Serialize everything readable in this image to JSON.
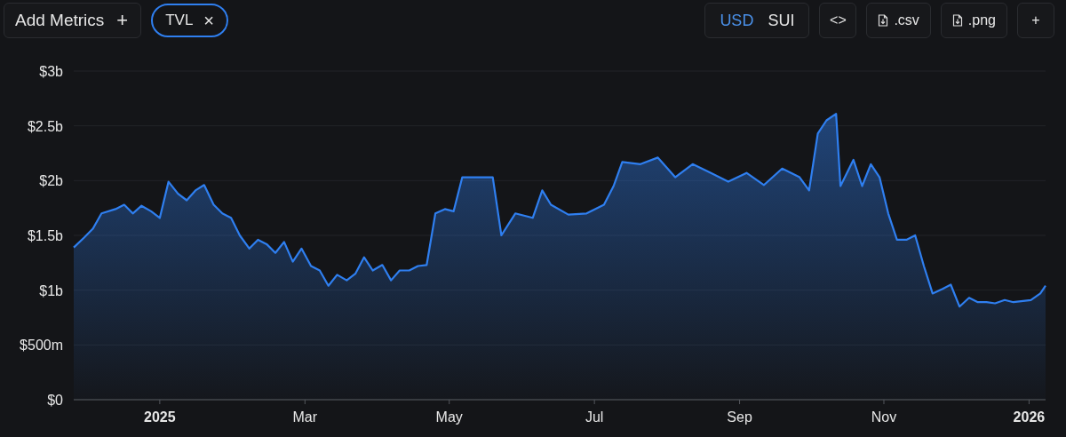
{
  "toolbar": {
    "add_metrics": {
      "label": "Add Metrics",
      "icon": "+"
    },
    "metric_tags": [
      {
        "remove": "×"
      }
    ],
    "units": [
      {
        "label": "USD",
        "selected": true
      },
      {
        "label": "SUI",
        "selected": false
      }
    ],
    "embed": {
      "icon": "<>"
    },
    "downloads": [
      {
        "label": ".csv"
      },
      {
        "label": ".png"
      }
    ],
    "add": {
      "icon": "+"
    }
  },
  "chart": {
    "chart_data": {
      "type": "area",
      "grid": true,
      "xlim": [
        2024.901,
        2026.019
      ],
      "ylim": [
        0,
        3000000000
      ],
      "xticks": [
        {
          "value": 2025,
          "label": "2025"
        },
        {
          "value": 2025.167,
          "label": "Mar"
        },
        {
          "value": 2025.333,
          "label": "May"
        },
        {
          "value": 2025.5,
          "label": "Jul"
        },
        {
          "value": 2025.667,
          "label": "Sep"
        },
        {
          "value": 2025.833,
          "label": "Nov"
        },
        {
          "value": 2026,
          "label": "2026"
        }
      ],
      "yticks": [
        {
          "value": 0,
          "label": "$0"
        },
        {
          "value": 500000000,
          "label": "$500m"
        },
        {
          "value": 1000000000,
          "label": "$1b"
        },
        {
          "value": 1500000000,
          "label": "$1.5b"
        },
        {
          "value": 2000000000,
          "label": "$2b"
        },
        {
          "value": 2500000000,
          "label": "$2.5b"
        },
        {
          "value": 3000000000,
          "label": "$3b"
        }
      ],
      "x": [
        2024.901,
        2024.913,
        2024.923,
        2024.933,
        2024.949,
        2024.959,
        2024.969,
        2024.979,
        2024.99,
        2025,
        2025.01,
        2025.021,
        2025.031,
        2025.041,
        2025.051,
        2025.062,
        2025.072,
        2025.082,
        2025.092,
        2025.103,
        2025.113,
        2025.123,
        2025.133,
        2025.143,
        2025.153,
        2025.163,
        2025.174,
        2025.184,
        2025.194,
        2025.204,
        2025.215,
        2025.225,
        2025.235,
        2025.245,
        2025.256,
        2025.266,
        2025.276,
        2025.287,
        2025.297,
        2025.307,
        2025.317,
        2025.328,
        2025.338,
        2025.348,
        2025.368,
        2025.383,
        2025.393,
        2025.409,
        2025.429,
        2025.44,
        2025.45,
        2025.47,
        2025.491,
        2025.511,
        2025.522,
        2025.532,
        2025.553,
        2025.573,
        2025.593,
        2025.613,
        2025.634,
        2025.654,
        2025.675,
        2025.695,
        2025.716,
        2025.736,
        2025.747,
        2025.757,
        2025.767,
        2025.778,
        2025.783,
        2025.798,
        2025.808,
        2025.818,
        2025.828,
        2025.838,
        2025.848,
        2025.859,
        2025.869,
        2025.879,
        2025.889,
        2025.9,
        2025.91,
        2025.92,
        2025.931,
        2025.941,
        2025.951,
        2025.961,
        2025.972,
        2025.982,
        2026.002,
        2026.013,
        2026.019
      ],
      "series": [
        {
          "name": "TVL",
          "color": "#2f7ff0",
          "values": [
            1390000000,
            1480000000,
            1560000000,
            1700000000,
            1740000000,
            1780000000,
            1700000000,
            1770000000,
            1720000000,
            1660000000,
            1990000000,
            1880000000,
            1820000000,
            1910000000,
            1960000000,
            1780000000,
            1700000000,
            1660000000,
            1500000000,
            1380000000,
            1460000000,
            1420000000,
            1340000000,
            1440000000,
            1260000000,
            1380000000,
            1220000000,
            1180000000,
            1040000000,
            1140000000,
            1090000000,
            1150000000,
            1300000000,
            1180000000,
            1230000000,
            1090000000,
            1180000000,
            1180000000,
            1220000000,
            1230000000,
            1700000000,
            1740000000,
            1720000000,
            2030000000,
            2030000000,
            2030000000,
            1500000000,
            1700000000,
            1660000000,
            1910000000,
            1780000000,
            1690000000,
            1700000000,
            1780000000,
            1950000000,
            2170000000,
            2150000000,
            2210000000,
            2030000000,
            2150000000,
            2070000000,
            1990000000,
            2070000000,
            1960000000,
            2110000000,
            2030000000,
            1910000000,
            2430000000,
            2550000000,
            2610000000,
            1950000000,
            2190000000,
            1950000000,
            2150000000,
            2030000000,
            1700000000,
            1460000000,
            1460000000,
            1500000000,
            1220000000,
            970000000,
            1010000000,
            1050000000,
            850000000,
            930000000,
            890000000,
            890000000,
            880000000,
            910000000,
            890000000,
            910000000,
            970000000,
            1040000000
          ]
        }
      ]
    }
  }
}
